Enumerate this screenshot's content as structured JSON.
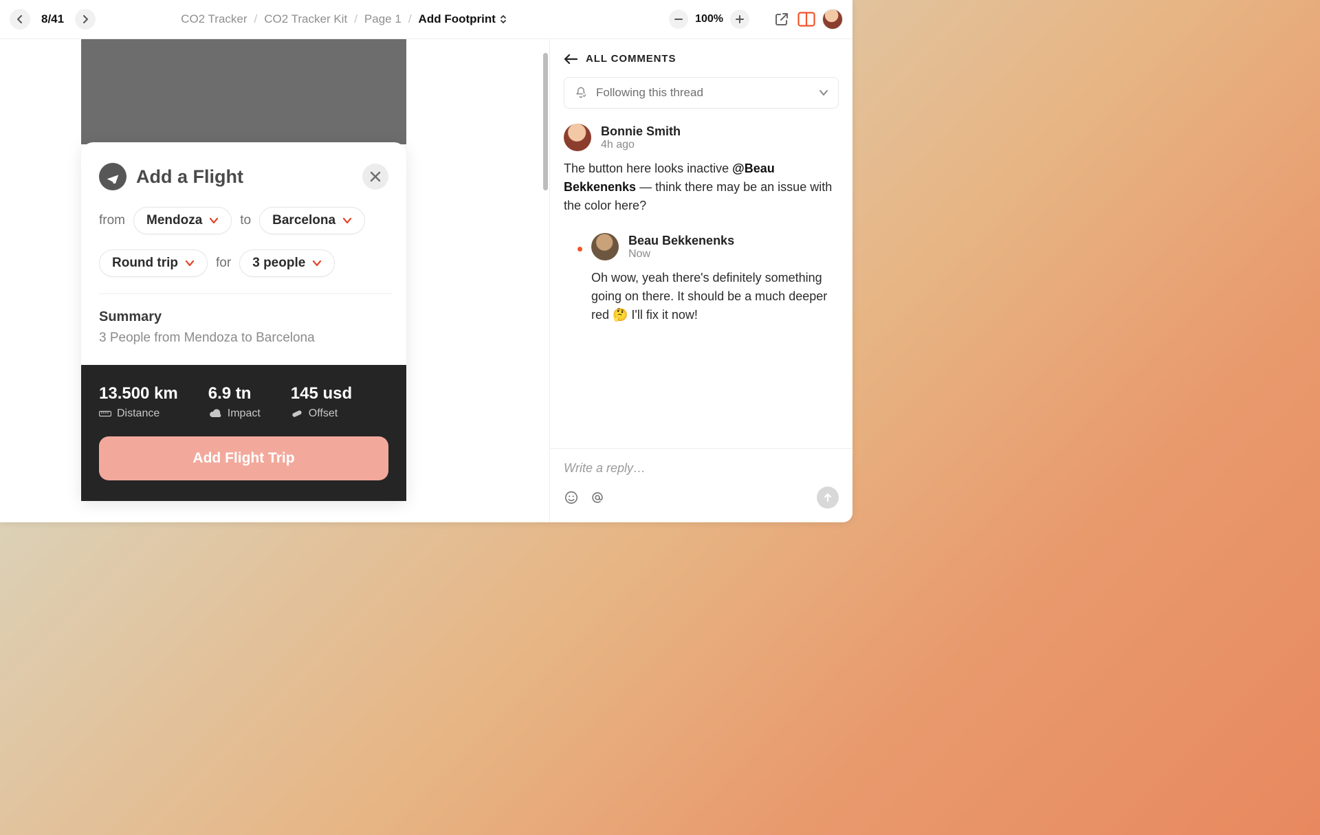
{
  "topbar": {
    "page_counter": "8/41",
    "breadcrumbs": [
      "CO2 Tracker",
      "CO2 Tracker Kit",
      "Page 1"
    ],
    "current": "Add Footprint",
    "zoom": "100%"
  },
  "flight": {
    "title": "Add a Flight",
    "from_label": "from",
    "from_value": "Mendoza",
    "to_label": "to",
    "to_value": "Barcelona",
    "trip_type": "Round trip",
    "for_label": "for",
    "people": "3 people",
    "summary_title": "Summary",
    "summary_text": "3 People from Mendoza to Barcelona",
    "stats": {
      "distance_value": "13.500 km",
      "distance_label": "Distance",
      "impact_value": "6.9 tn",
      "impact_label": "Impact",
      "offset_value": "145 usd",
      "offset_label": "Offset"
    },
    "cta": "Add Flight Trip"
  },
  "comments": {
    "header": "ALL COMMENTS",
    "follow": "Following this thread",
    "items": [
      {
        "author": "Bonnie Smith",
        "time": "4h ago",
        "text_before": "The button here looks inactive ",
        "mention": "@Beau Bekkenenks",
        "text_after": " — think there may be an issue with the color here?"
      },
      {
        "author": "Beau Bekkenenks",
        "time": "Now",
        "text": "Oh wow, yeah there's definitely something going on there. It should be a much deeper red 🤔 I'll fix it now!"
      }
    ],
    "reply_placeholder": "Write a reply…"
  }
}
